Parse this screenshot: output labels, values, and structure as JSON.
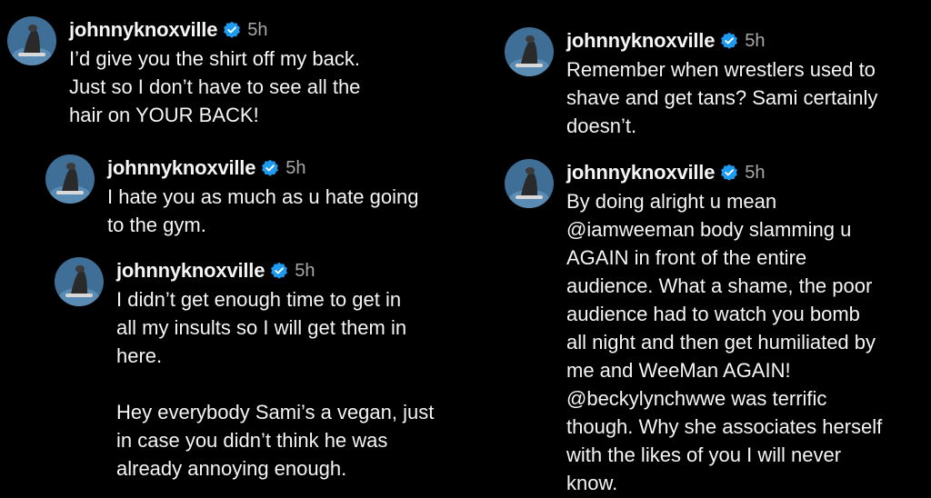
{
  "accent_verified": "#1d9bf0",
  "comments": [
    {
      "username": "johnnyknoxville",
      "time": "5h",
      "text": "I’d give you the shirt off my back.\nJust so I don’t have to see all the\nhair on YOUR BACK!"
    },
    {
      "username": "johnnyknoxville",
      "time": "5h",
      "text": "I hate you as much as u hate going\nto the gym."
    },
    {
      "username": "johnnyknoxville",
      "time": "5h",
      "text": "I didn’t get enough time to get in\nall my insults so I will get them in\nhere.\n\nHey everybody Sami’s a vegan, just\nin case you didn’t think he was\nalready annoying enough."
    },
    {
      "username": "johnnyknoxville",
      "time": "5h",
      "text": "Remember when wrestlers used to\nshave and get tans? Sami certainly\ndoesn’t."
    },
    {
      "username": "johnnyknoxville",
      "time": "5h",
      "text": "By doing alright u mean\n@iamweeman body slamming u\nAGAIN in front of the entire\naudience. What a shame, the poor\naudience had to watch you bomb\nall night and then get humiliated by\nme and WeeMan AGAIN!\n@beckylynchwwe was terrific\nthough. Why she associates herself\nwith the likes of you I will never\nknow."
    }
  ]
}
